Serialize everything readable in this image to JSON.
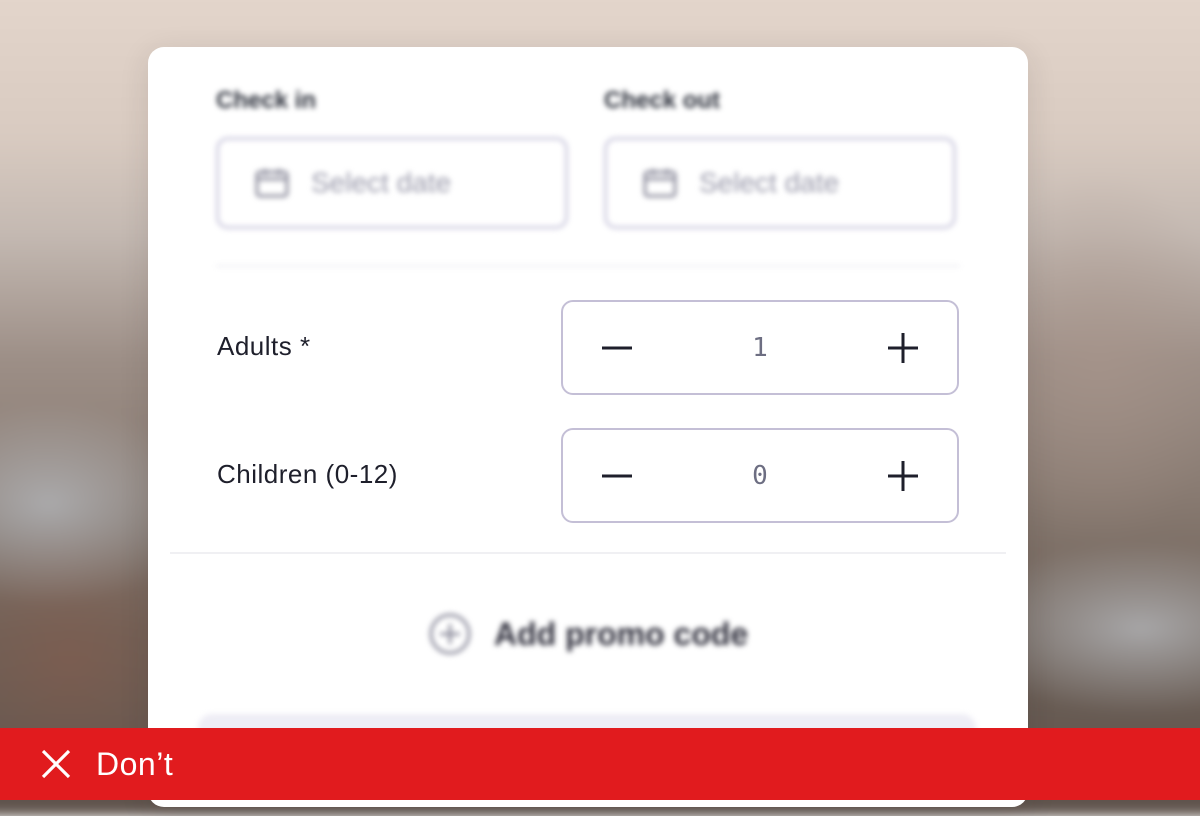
{
  "booking": {
    "check_in": {
      "label": "Check in",
      "placeholder": "Select date"
    },
    "check_out": {
      "label": "Check out",
      "placeholder": "Select date"
    },
    "adults": {
      "label": "Adults *",
      "value": "1"
    },
    "children": {
      "label": "Children (0-12)",
      "value": "0"
    },
    "promo": {
      "label": "Add promo code"
    }
  },
  "footer": {
    "label": "Don’t",
    "color": "#e11b1e"
  },
  "icons": {
    "calendar": "calendar-icon",
    "minus": "minus-icon",
    "plus": "plus-icon",
    "add": "plus-circle-icon",
    "close": "close-icon"
  }
}
